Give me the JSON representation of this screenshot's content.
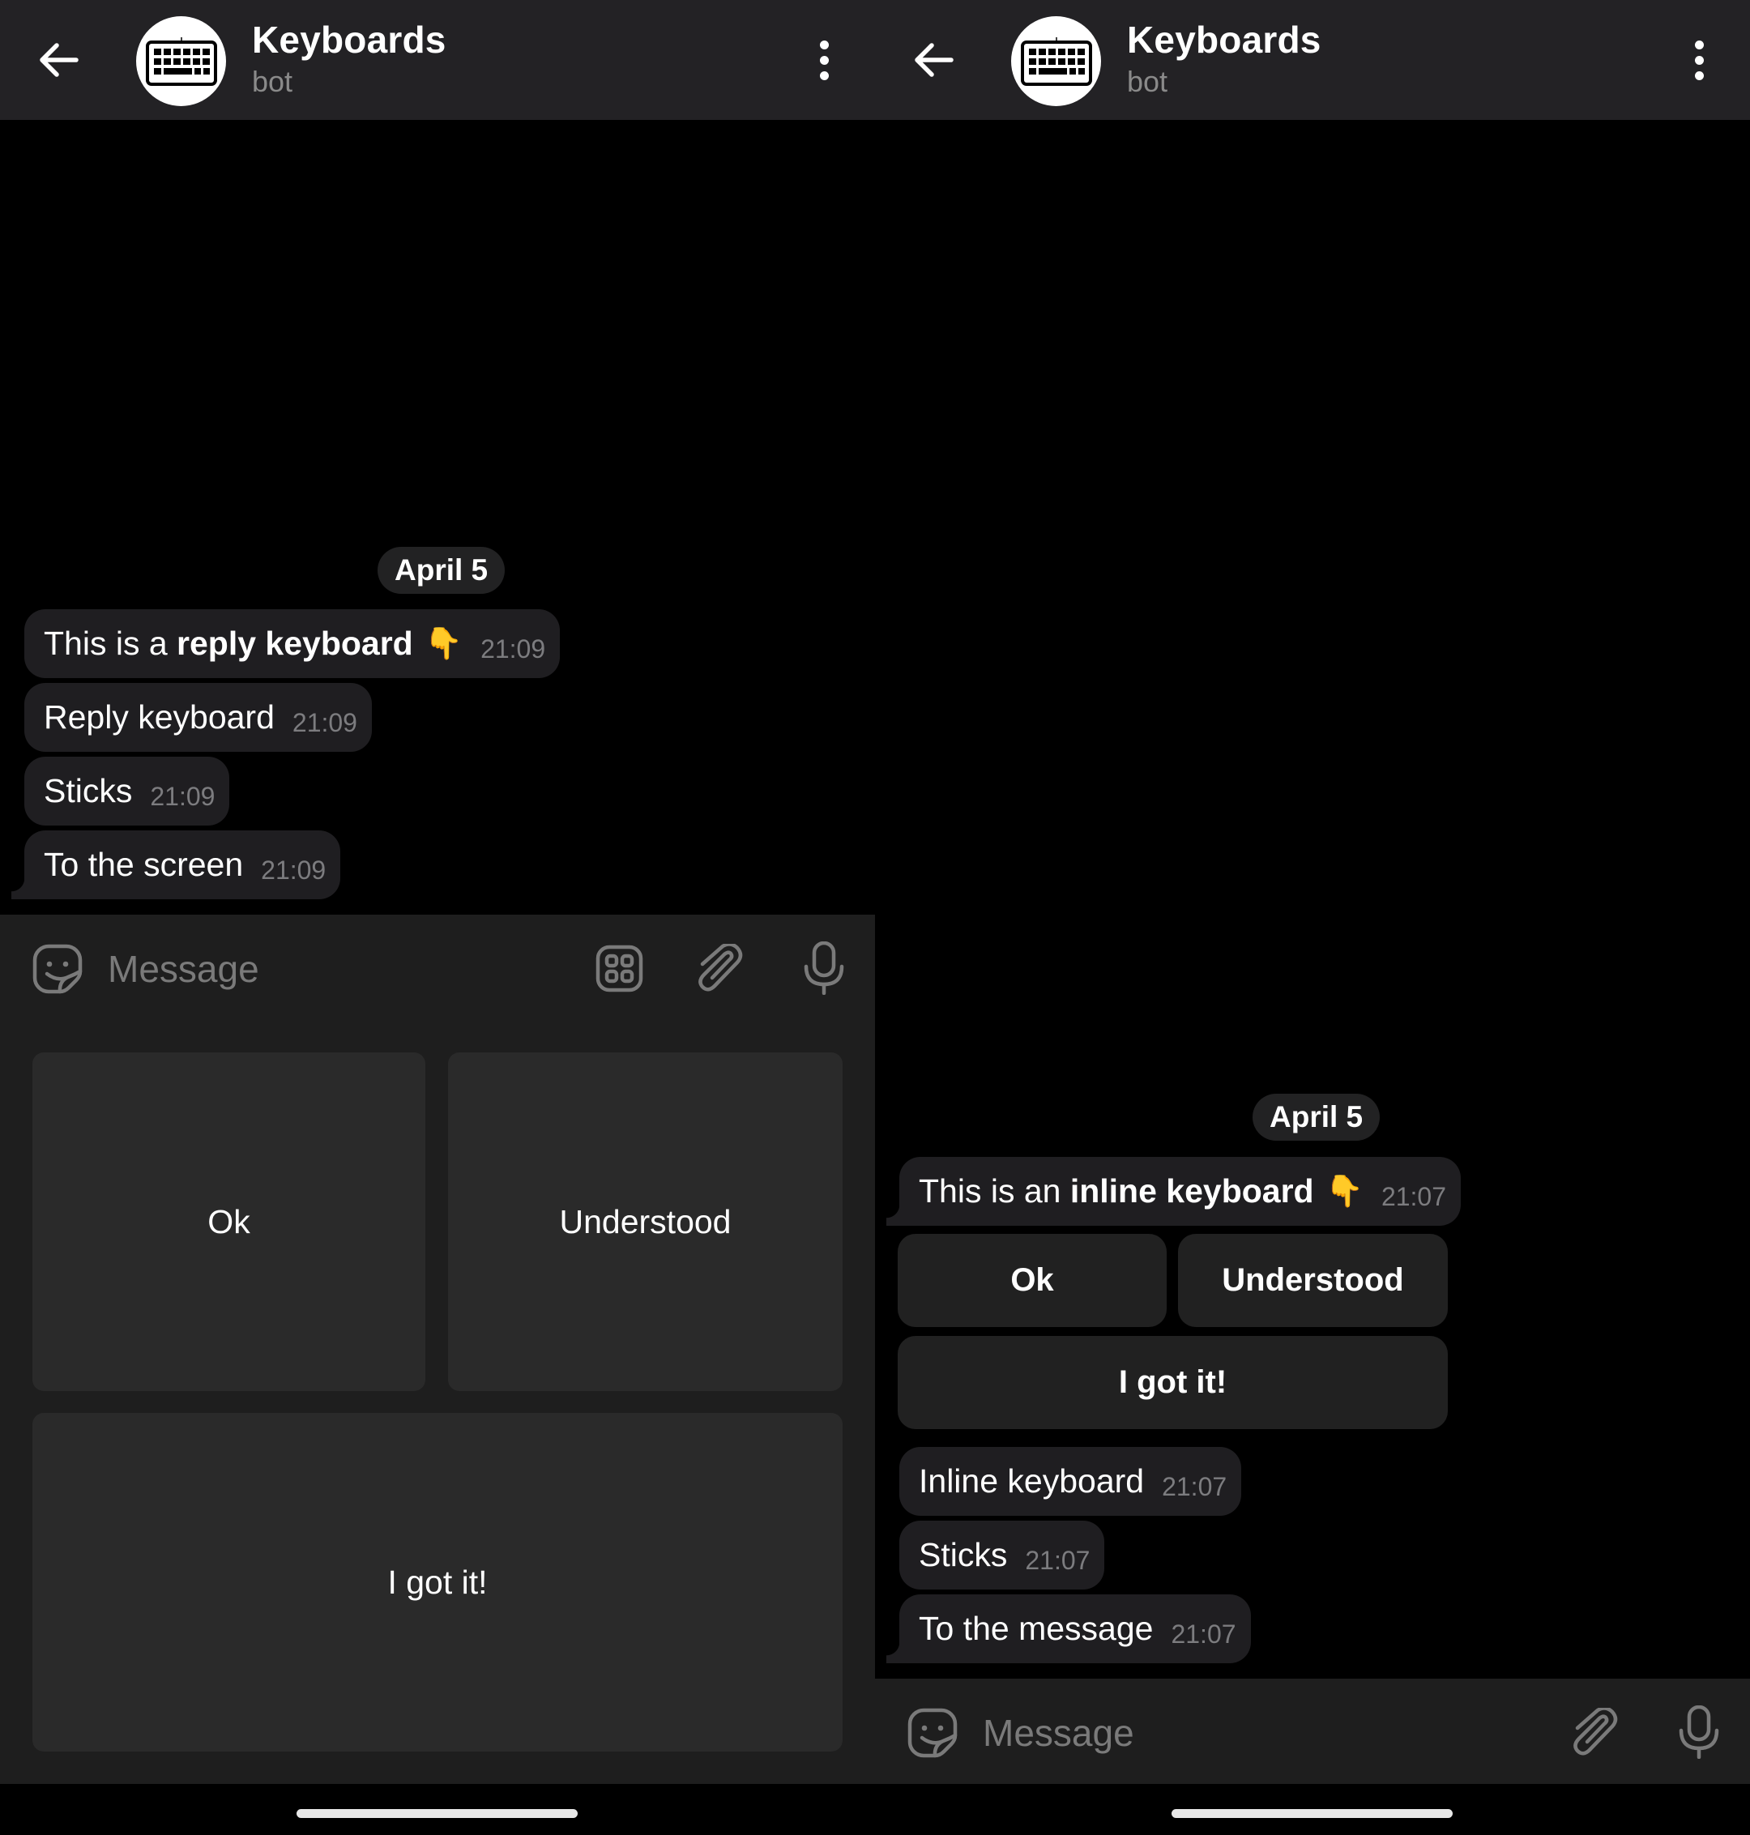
{
  "panes": {
    "left": {
      "header": {
        "title": "Keyboards",
        "subtitle": "bot",
        "avatar_icon": "keyboard-icon",
        "back_icon": "arrow-left-icon",
        "menu_icon": "more-vertical-icon"
      },
      "date": "April 5",
      "messages": [
        {
          "text_plain": "This is a ",
          "text_bold": "reply keyboard",
          "emoji": "👇",
          "time": "21:09"
        },
        {
          "text": "Reply keyboard",
          "time": "21:09"
        },
        {
          "text": "Sticks",
          "time": "21:09"
        },
        {
          "text": "To the screen",
          "time": "21:09"
        }
      ],
      "input": {
        "placeholder": "Message",
        "value": "",
        "icons": [
          "sticker-icon",
          "keyboard-toggle-icon",
          "paperclip-icon",
          "microphone-icon"
        ]
      },
      "reply_keyboard": {
        "rows": [
          [
            "Ok",
            "Understood"
          ],
          [
            "I got it!"
          ]
        ]
      }
    },
    "right": {
      "header": {
        "title": "Keyboards",
        "subtitle": "bot",
        "avatar_icon": "keyboard-icon",
        "back_icon": "arrow-left-icon",
        "menu_icon": "more-vertical-icon"
      },
      "date": "April 5",
      "keyboard_message": {
        "text_plain": "This is an ",
        "text_bold": "inline keyboard",
        "emoji": "👇",
        "time": "21:07"
      },
      "inline_keyboard": {
        "rows": [
          [
            "Ok",
            "Understood"
          ],
          [
            "I got it!"
          ]
        ]
      },
      "messages": [
        {
          "text": "Inline keyboard",
          "time": "21:07"
        },
        {
          "text": "Sticks",
          "time": "21:07"
        },
        {
          "text": "To the message",
          "time": "21:07"
        }
      ],
      "input": {
        "placeholder": "Message",
        "value": "",
        "icons": [
          "sticker-icon",
          "paperclip-icon",
          "microphone-icon"
        ]
      }
    }
  },
  "colors": {
    "header_bg": "#232225",
    "chat_bg": "#000000",
    "bubble_bg": "#1f1e21",
    "input_bg": "#1e1e1e",
    "reply_button_bg": "#2a2a2a",
    "inline_button_bg": "#212121",
    "timestamp": "#7c7c7f",
    "placeholder": "#7a7a7a"
  }
}
